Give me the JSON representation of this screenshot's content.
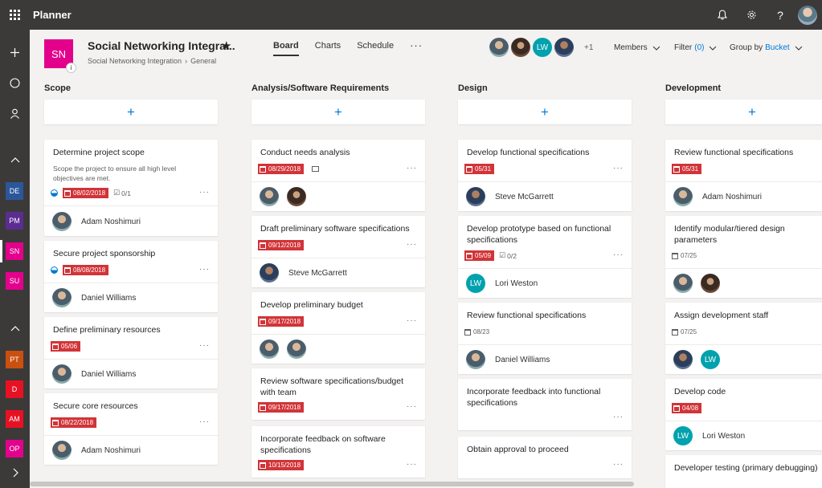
{
  "app": {
    "title": "Planner"
  },
  "topbar": {
    "icons": [
      "bell-icon",
      "gear-icon",
      "help-icon"
    ],
    "help_glyph": "?"
  },
  "rail": {
    "top_icons": [
      "add-icon",
      "circle-icon",
      "person-icon"
    ],
    "group1": [
      {
        "label": "DE",
        "color": "#2b579a"
      },
      {
        "label": "PM",
        "color": "#5c2d91"
      },
      {
        "label": "SN",
        "color": "#e3008c",
        "active": true
      },
      {
        "label": "SU",
        "color": "#e3008c"
      }
    ],
    "group2": [
      {
        "label": "PT",
        "color": "#ca5010"
      },
      {
        "label": "D",
        "color": "#e81123"
      },
      {
        "label": "AM",
        "color": "#e81123"
      },
      {
        "label": "OP",
        "color": "#e3008c"
      }
    ]
  },
  "plan": {
    "logo": "SN",
    "logo_badge": "i",
    "title": "Social Networking Integra...",
    "breadcrumb": [
      "Social Networking Integration",
      "General"
    ]
  },
  "tabs": [
    {
      "label": "Board",
      "active": true
    },
    {
      "label": "Charts"
    },
    {
      "label": "Schedule"
    }
  ],
  "tab_more": "···",
  "members": {
    "lw": "LW",
    "extra": "+1",
    "label": "Members"
  },
  "filter": {
    "label": "Filter",
    "count": "(0)"
  },
  "group_by": {
    "label": "Group by",
    "value": "Bucket"
  },
  "columns": [
    {
      "title": "Scope",
      "cards": [
        {
          "title": "Determine project scope",
          "desc": "Scope the project to ensure all high level objectives are met.",
          "due": "08/02/2018",
          "checklist": "0/1",
          "progress": true,
          "assignee": "Adam Noshimuri"
        },
        {
          "title": "Secure project sponsorship",
          "due": "08/08/2018",
          "progress": true,
          "assignee": "Daniel Williams"
        },
        {
          "title": "Define preliminary resources",
          "due": "05/06",
          "assignee": "Daniel Williams"
        },
        {
          "title": "Secure core resources",
          "due": "08/22/2018",
          "assignee": "Adam Noshimuri"
        }
      ]
    },
    {
      "title": "Analysis/Software Requirements",
      "cards": [
        {
          "title": "Conduct needs analysis",
          "due": "08/29/2018",
          "comment": true
        },
        {
          "title": "Draft preliminary software specifications",
          "due": "09/12/2018",
          "assignee": "Steve McGarrett"
        },
        {
          "title": "Develop preliminary budget",
          "due": "09/17/2018"
        },
        {
          "title": "Review software specifications/budget with team",
          "due": "09/17/2018"
        },
        {
          "title": "Incorporate feedback on software specifications",
          "due": "10/15/2018"
        }
      ]
    },
    {
      "title": "Design",
      "cards": [
        {
          "title": "Develop functional specifications",
          "due": "05/31",
          "assignee": "Steve McGarrett"
        },
        {
          "title": "Develop prototype based on functional specifications",
          "due": "05/09",
          "checklist": "0/2",
          "assignee": "Lori Weston",
          "initials": "LW"
        },
        {
          "title": "Review functional specifications",
          "due": "08/23",
          "assignee": "Daniel Williams"
        },
        {
          "title": "Incorporate feedback into functional specifications"
        },
        {
          "title": "Obtain approval to proceed"
        }
      ]
    },
    {
      "title": "Development",
      "cards": [
        {
          "title": "Review functional specifications",
          "due": "05/31",
          "assignee": "Adam Noshimuri"
        },
        {
          "title": "Identify modular/tiered design parameters",
          "due": "07/25"
        },
        {
          "title": "Assign development staff",
          "due": "07/25",
          "initials": "LW"
        },
        {
          "title": "Develop code",
          "due": "04/08",
          "assignee": "Lori Weston",
          "initials": "LW"
        },
        {
          "title": "Developer testing (primary debugging)"
        }
      ]
    }
  ],
  "more_glyph": "···",
  "add_glyph": "+"
}
